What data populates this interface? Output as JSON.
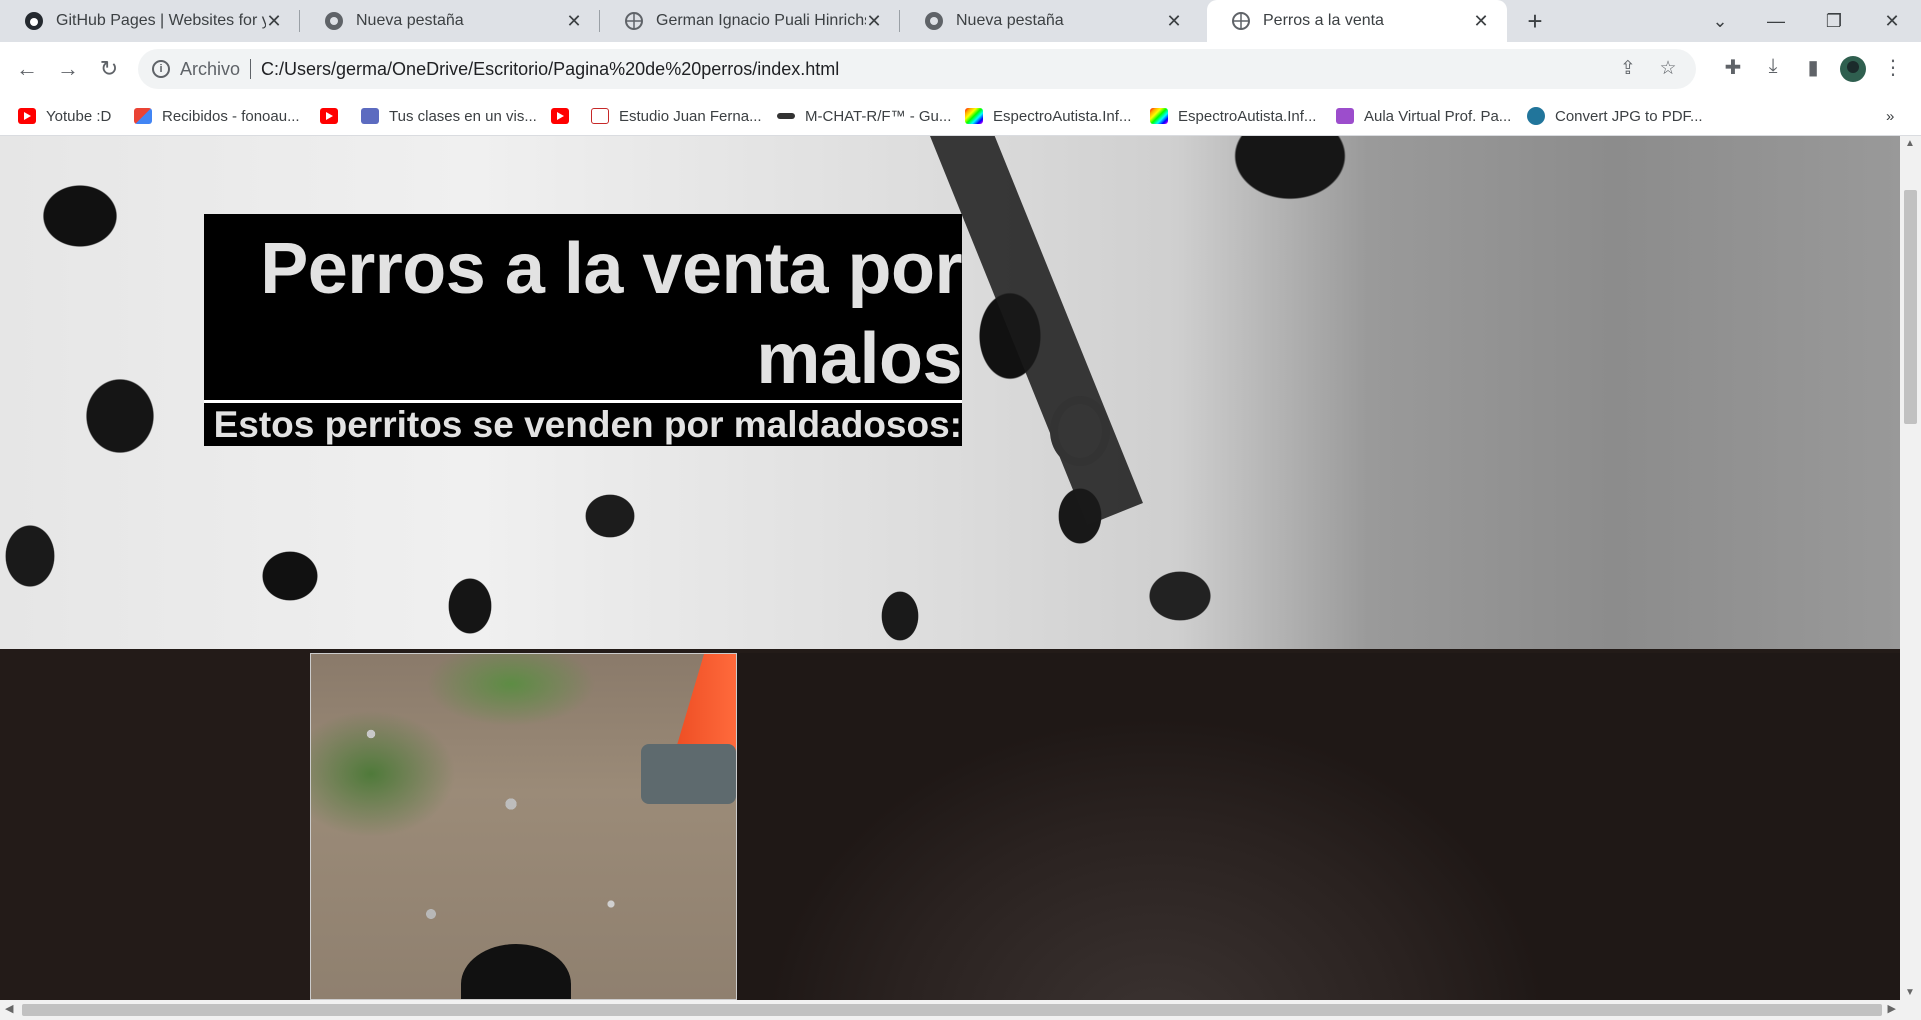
{
  "browser": {
    "tabs": [
      {
        "title": "GitHub Pages | Websites for you",
        "icon": "github-icon",
        "active": false
      },
      {
        "title": "Nueva pestaña",
        "icon": "chrome-icon",
        "active": false
      },
      {
        "title": "German Ignacio Puali Hinrichsen",
        "icon": "globe-icon",
        "active": false
      },
      {
        "title": "Nueva pestaña",
        "icon": "chrome-icon",
        "active": false
      },
      {
        "title": "Perros a la venta",
        "icon": "globe-icon",
        "active": true
      }
    ],
    "close_glyph": "✕",
    "new_tab_glyph": "+",
    "address": {
      "label": "Archivo",
      "url": "C:/Users/germa/OneDrive/Escritorio/Pagina%20de%20perros/index.html"
    },
    "bookmarks": [
      {
        "label": "Yotube :D",
        "icon": "youtube-icon"
      },
      {
        "label": "Recibidos - fonoau...",
        "icon": "gmail-icon"
      },
      {
        "label": "",
        "icon": "youtube-icon"
      },
      {
        "label": "Tus clases en un vis...",
        "icon": "app-icon"
      },
      {
        "label": "",
        "icon": "youtube-icon"
      },
      {
        "label": "Estudio Juan Ferna...",
        "icon": "studio-icon"
      },
      {
        "label": "M-CHAT-R/F™ - Gu...",
        "icon": "mchat-icon"
      },
      {
        "label": "EspectroAutista.Inf...",
        "icon": "spectrum-icon"
      },
      {
        "label": "EspectroAutista.Inf...",
        "icon": "spectrum-icon"
      },
      {
        "label": "Aula Virtual Prof. Pa...",
        "icon": "aula-icon"
      },
      {
        "label": "Convert JPG to PDF...",
        "icon": "wordpress-icon"
      }
    ],
    "bookmarks_more": "»"
  },
  "page": {
    "title": "Perros a la venta por malos",
    "subtitle": "Estos perritos se venden por maldadosos:"
  },
  "colors": {
    "title_bg": "#000000",
    "title_text": "#e2e2e2",
    "gallery_bg": "#231b18"
  }
}
